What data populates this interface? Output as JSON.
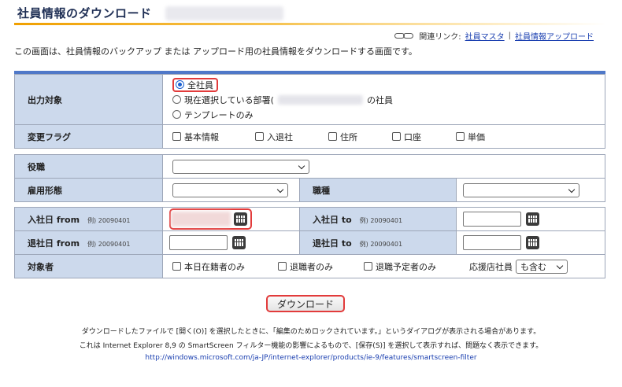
{
  "header": {
    "title": "社員情報のダウンロード"
  },
  "related_links": {
    "label": "関連リンク:",
    "link1": "社員マスタ",
    "separator": "|",
    "link2": "社員情報アップロード"
  },
  "description": "この画面は、社員情報のバックアップ または アップロード用の社員情報をダウンロードする画面です。",
  "output_target": {
    "label": "出力対象",
    "options": [
      "全社員",
      "現在選択している部署(",
      "の社員",
      "テンプレートのみ"
    ],
    "selected": "全社員"
  },
  "change_flags": {
    "label": "変更フラグ",
    "items": [
      "基本情報",
      "入退社",
      "住所",
      "口座",
      "単価"
    ]
  },
  "position": {
    "label": "役職",
    "value": ""
  },
  "employment_type": {
    "label": "雇用形態",
    "value": ""
  },
  "job_type": {
    "label": "職種",
    "value": ""
  },
  "join_from": {
    "label": "入社日 from",
    "hint": "例) 20090401"
  },
  "join_to": {
    "label": "入社日 to",
    "hint": "例) 20090401"
  },
  "leave_from": {
    "label": "退社日 from",
    "hint": "例) 20090401"
  },
  "leave_to": {
    "label": "退社日 to",
    "hint": "例) 20090401"
  },
  "target": {
    "label": "対象者",
    "options": [
      "本日在籍者のみ",
      "退職者のみ",
      "退職予定者のみ"
    ],
    "support_label": "応援店社員",
    "support_value": "も含む"
  },
  "download_button": "ダウンロード",
  "notes": {
    "line1": "ダウンロードしたファイルで [開く(O)] を選択したときに、「編集のためロックされています。」というダイアログが表示される場合があります。",
    "line2": "これは Internet Explorer 8,9 の SmartScreen フィルター機能の影響によるもので、[保存(S)] を選択して表示すれば、問題なく表示できます。",
    "link": "http://windows.microsoft.com/ja-JP/internet-explorer/products/ie-9/features/smartscreen-filter"
  },
  "colors": {
    "label_bg": "#ccd9ec",
    "border": "#9da6b8",
    "highlight": "#e23b3b",
    "accent_bar": "#4f78c8",
    "title_underline": "#f0a000",
    "link": "#1a3fb0"
  }
}
